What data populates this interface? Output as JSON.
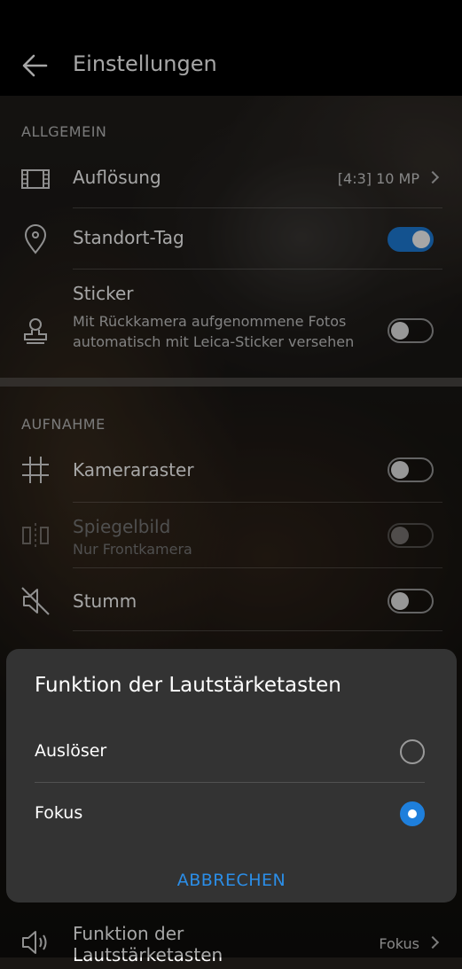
{
  "header": {
    "title": "Einstellungen"
  },
  "sections": {
    "general": "ALLGEMEIN",
    "capture": "AUFNAHME"
  },
  "settings": {
    "resolution": {
      "label": "Auflösung",
      "value": "[4:3] 10 MP"
    },
    "location_tag": {
      "label": "Standort-Tag",
      "on": true
    },
    "sticker": {
      "label": "Sticker",
      "description": "Mit Rückkamera aufgenommene Fotos automatisch mit Leica-Sticker versehen",
      "on": false
    },
    "camera_grid": {
      "label": "Kameraraster",
      "on": false
    },
    "mirror": {
      "label": "Spiegelbild",
      "sub": "Nur Frontkamera",
      "on": false,
      "enabled": false
    },
    "mute": {
      "label": "Stumm",
      "on": false
    },
    "volume_keys": {
      "label": "Funktion der Lautstärketasten",
      "value": "Fokus"
    }
  },
  "dialog": {
    "title": "Funktion der Lautstärketasten",
    "options": [
      {
        "label": "Auslöser",
        "selected": false
      },
      {
        "label": "Fokus",
        "selected": true
      }
    ],
    "cancel_label": "ABBRECHEN"
  },
  "colors": {
    "accent": "#1e7fdc",
    "link": "#2b8ee8",
    "dialog_bg": "#333333"
  },
  "icons": [
    "back-arrow-icon",
    "resolution-film-icon",
    "location-pin-icon",
    "sticker-stamp-icon",
    "grid-icon",
    "mirror-icon",
    "mute-speaker-icon",
    "volume-speaker-icon",
    "chevron-right-icon"
  ]
}
